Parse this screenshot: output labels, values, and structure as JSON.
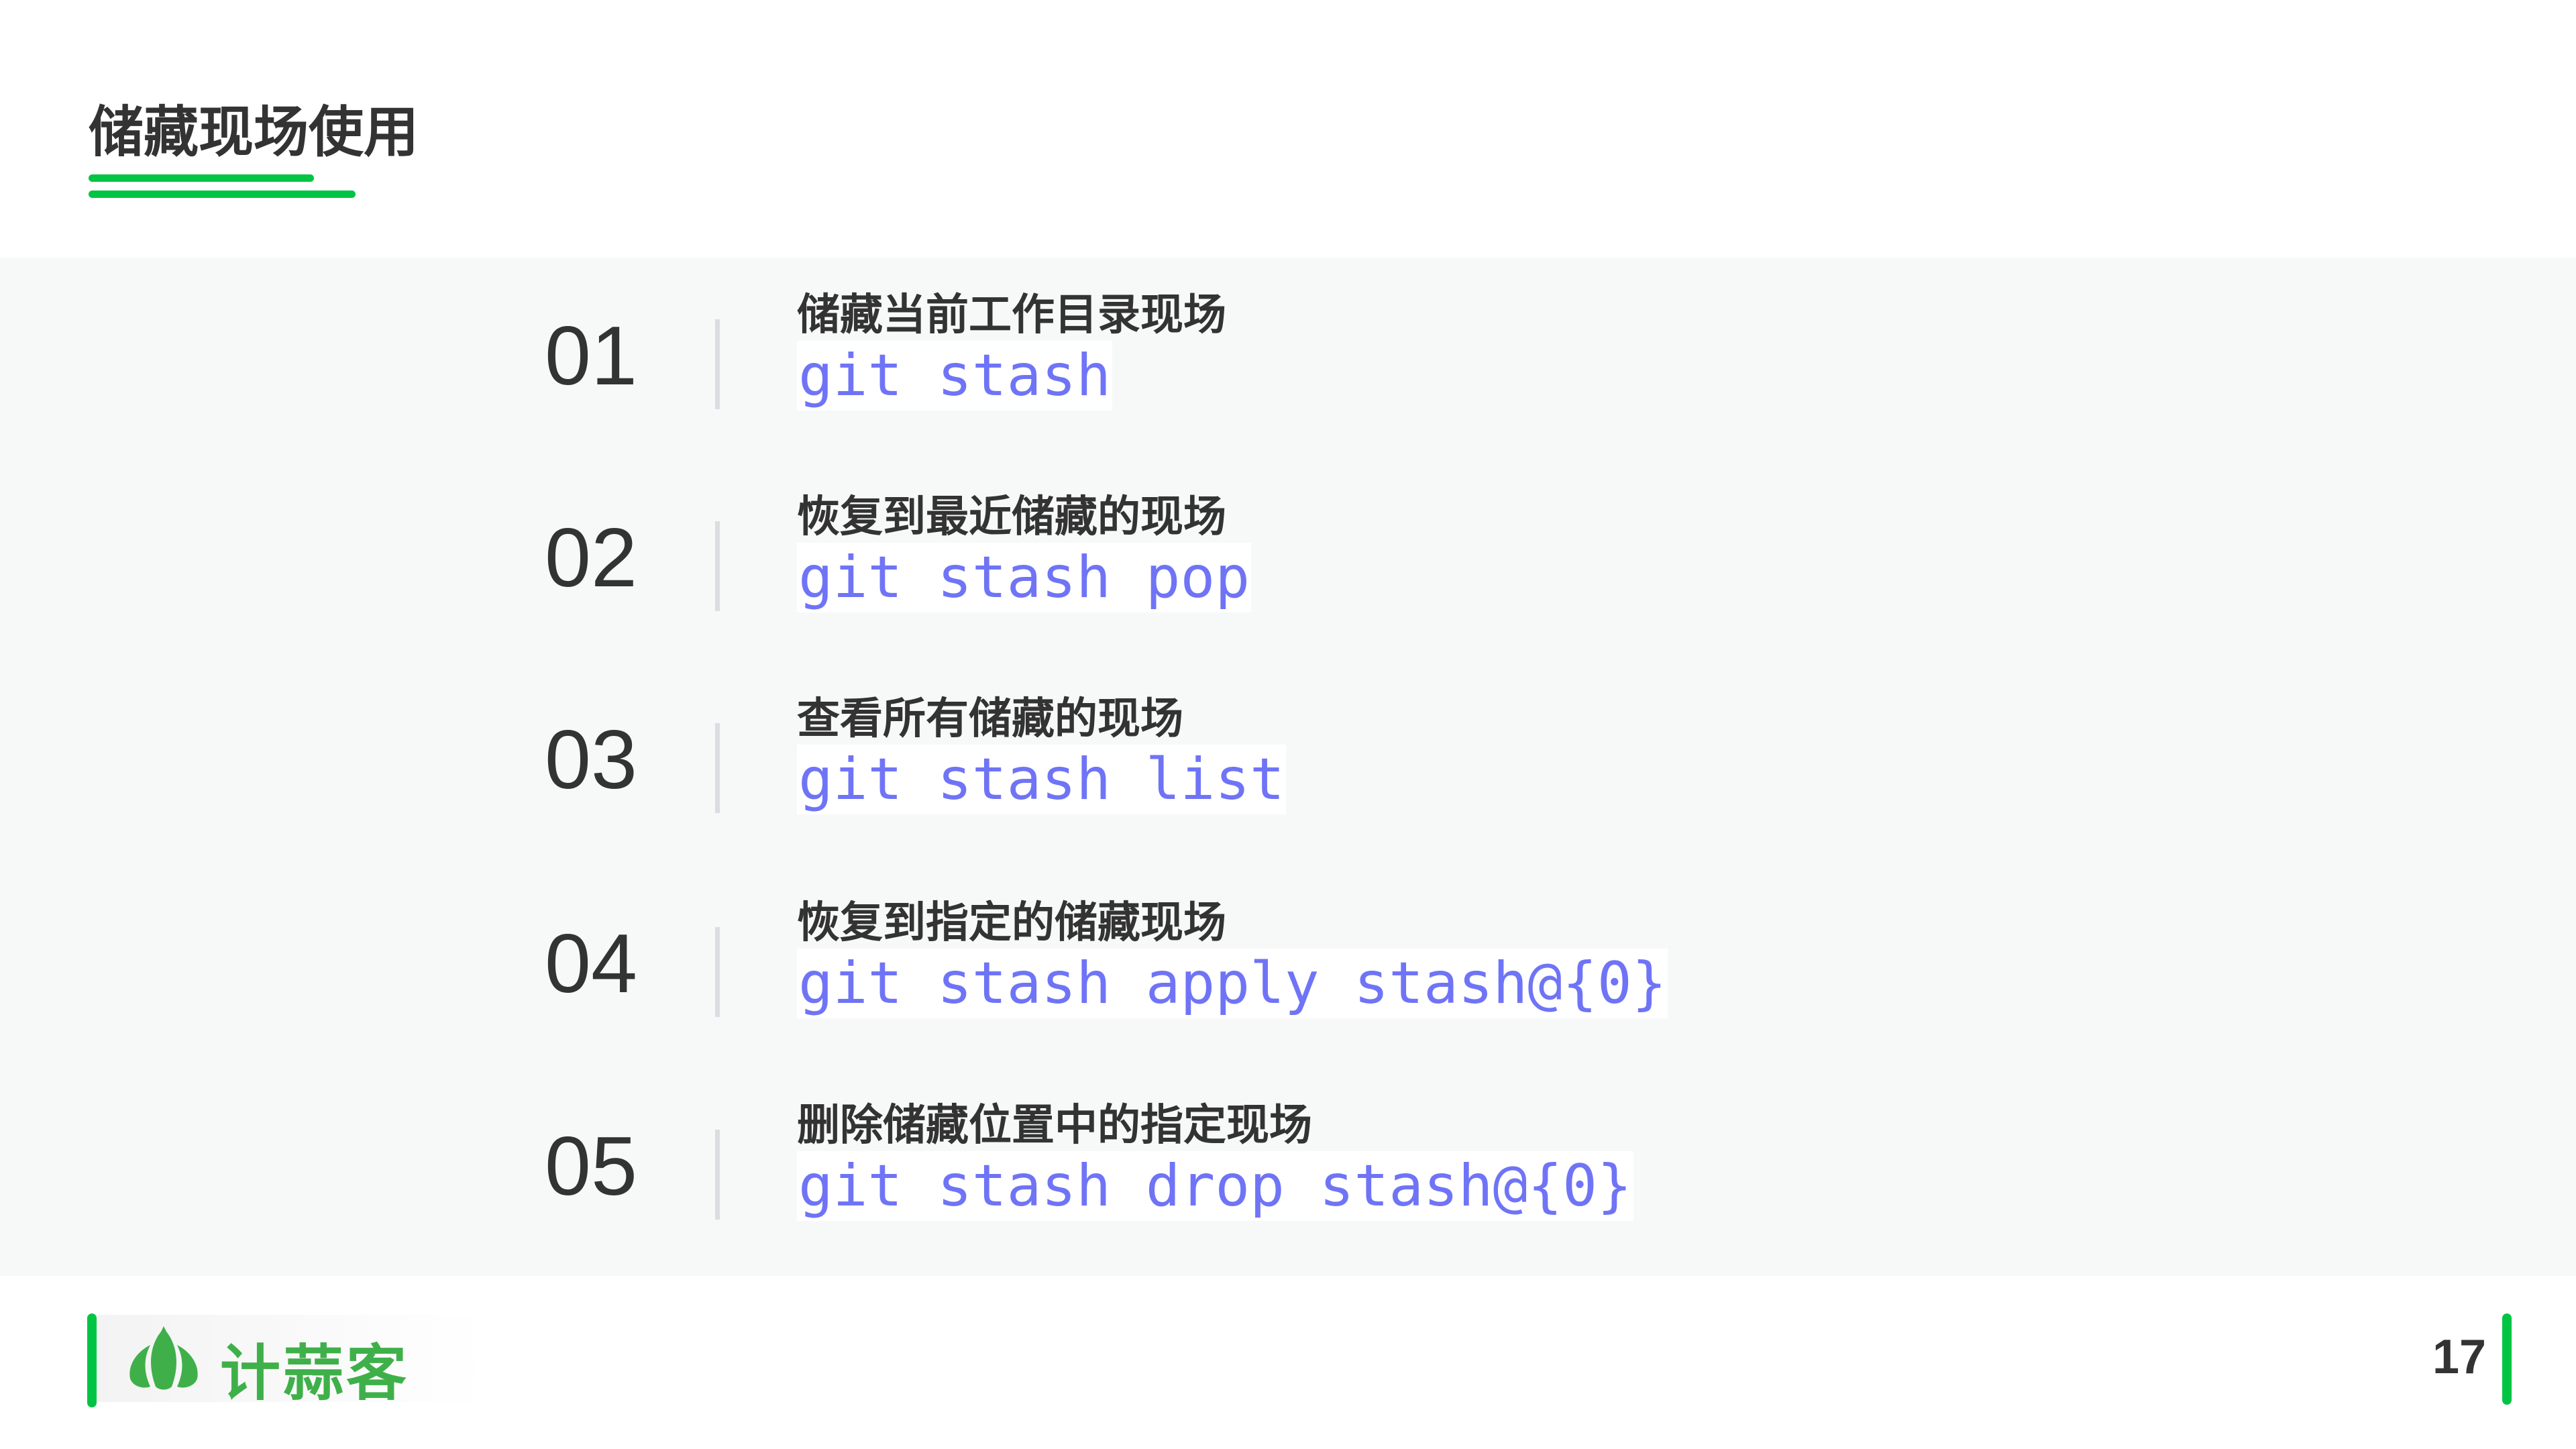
{
  "title": "储藏现场使用",
  "items": [
    {
      "num": "01",
      "heading": "储藏当前工作目录现场",
      "code": "git stash"
    },
    {
      "num": "02",
      "heading": "恢复到最近储藏的现场",
      "code": "git stash pop"
    },
    {
      "num": "03",
      "heading": "查看所有储藏的现场",
      "code": "git stash list"
    },
    {
      "num": "04",
      "heading": "恢复到指定的储藏现场",
      "code": "git stash apply stash@{0}"
    },
    {
      "num": "05",
      "heading": "删除储藏位置中的指定现场",
      "code": "git stash drop stash@{0}"
    }
  ],
  "footer": {
    "logo_text": "计蒜客",
    "page": "17"
  },
  "colors": {
    "accent": "#00c443",
    "code": "#6f74f6",
    "logo": "#3fb049"
  }
}
